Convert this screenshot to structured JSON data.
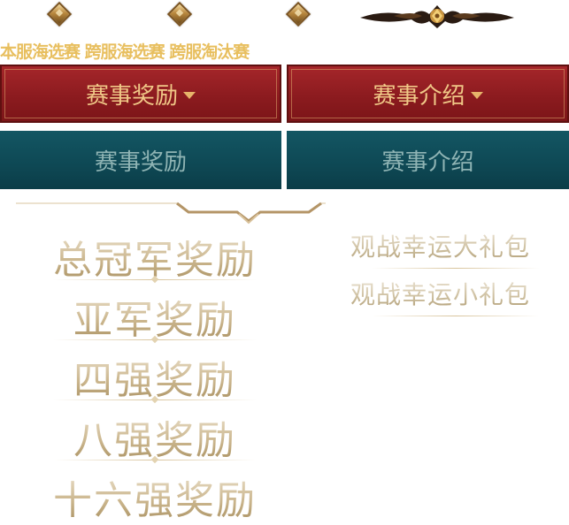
{
  "header": {
    "tabs": [
      "本服海选赛",
      "跨服海选赛",
      "跨服淘汰赛"
    ]
  },
  "buttons": {
    "rewards_active": "赛事奖励",
    "intro_active": "赛事介绍",
    "rewards_inactive": "赛事奖励",
    "intro_inactive": "赛事介绍"
  },
  "awards": [
    "总冠军奖励",
    "亚军奖励",
    "四强奖励",
    "八强奖励",
    "十六强奖励"
  ],
  "gifts": [
    "观战幸运大礼包",
    "观战幸运小礼包"
  ],
  "colors": {
    "tab_gold": "#e8bf5f",
    "red_button": "#8c1b1f",
    "teal_button": "#0e4854",
    "award_text": "#c9b48b"
  }
}
